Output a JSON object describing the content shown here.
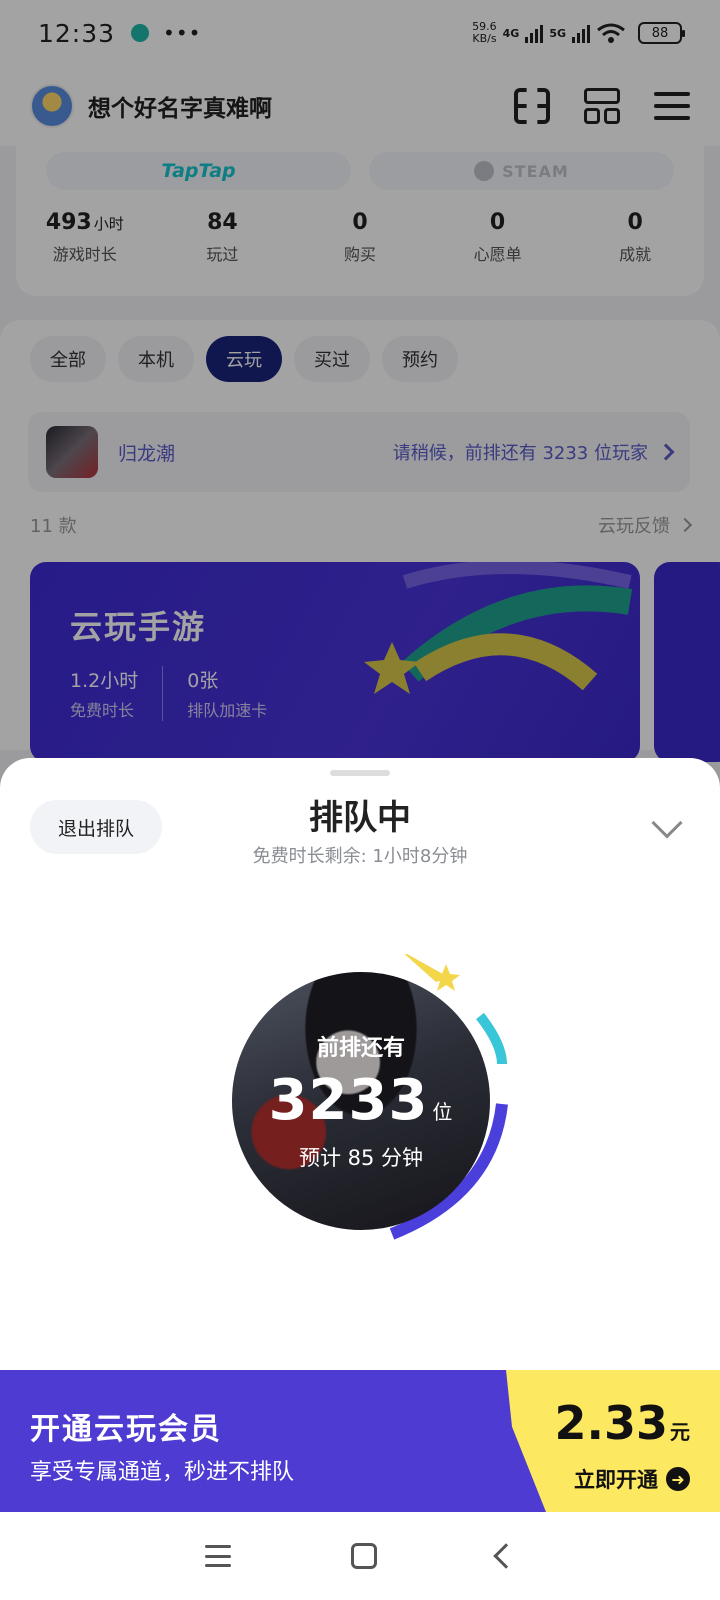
{
  "status_bar": {
    "time": "12:33",
    "app_badge": "云玩",
    "dots": "•••",
    "speed_value": "59.6",
    "speed_unit": "KB/s",
    "net1": "4G",
    "net2": "5G",
    "battery": "88"
  },
  "header": {
    "username": "想个好名字真难啊"
  },
  "platforms": {
    "tap": "TapTap",
    "steam": "STEAM"
  },
  "stats": [
    {
      "value": "493",
      "unit": "小时",
      "label": "游戏时长"
    },
    {
      "value": "84",
      "unit": "",
      "label": "玩过"
    },
    {
      "value": "0",
      "unit": "",
      "label": "购买"
    },
    {
      "value": "0",
      "unit": "",
      "label": "心愿单"
    },
    {
      "value": "0",
      "unit": "",
      "label": "成就"
    }
  ],
  "tabs": [
    {
      "label": "全部",
      "active": false
    },
    {
      "label": "本机",
      "active": false
    },
    {
      "label": "云玩",
      "active": true
    },
    {
      "label": "买过",
      "active": false
    },
    {
      "label": "预约",
      "active": false
    }
  ],
  "queue_banner": {
    "game_name": "归龙潮",
    "message": "请稍候，前排还有 3233 位玩家"
  },
  "list_meta": {
    "count": "11 款",
    "feedback": "云玩反馈"
  },
  "promo_card": {
    "title": "云玩手游",
    "stat1_value": "1.2小时",
    "stat1_label": "免费时长",
    "stat2_value": "0张",
    "stat2_label": "排队加速卡"
  },
  "sheet": {
    "exit_label": "退出排队",
    "title": "排队中",
    "subtitle": "免费时长剩余: 1小时8分钟",
    "ahead_label": "前排还有",
    "position": "3233",
    "position_unit": "位",
    "eta": "预计 85 分钟"
  },
  "member_bar": {
    "title": "开通云玩会员",
    "subtitle": "享受专属通道，秒进不排队",
    "price": "2.33",
    "price_unit": "元",
    "cta": "立即开通"
  },
  "colors": {
    "accent": "#4d3bd2",
    "active_tab": "#19237a",
    "cta_yellow": "#fde862",
    "link": "#5a5bc9"
  }
}
